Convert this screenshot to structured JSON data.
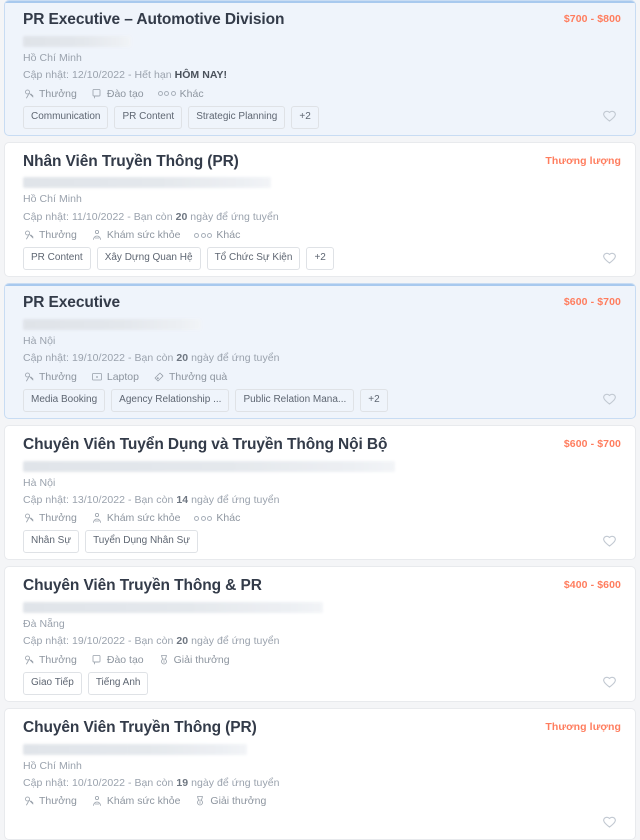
{
  "list": {
    "name": "job-search-results"
  },
  "icons": {
    "bonus": "bonus-icon",
    "training": "training-icon",
    "other": "other-benefits-icon",
    "healthcheck": "health-check-icon",
    "laptop": "laptop-icon",
    "gift": "gift-icon",
    "award": "award-icon",
    "favorite": "heart-outline-icon"
  },
  "colors": {
    "salary": "#ff7d5e",
    "highlight_bg": "#eff4fb",
    "highlight_border": "#c8dcf3",
    "title": "#333b49",
    "meta": "#9aa2ad"
  },
  "jobs": [
    {
      "title": "PR Executive – Automotive Division",
      "salary": "$700 - $800",
      "salary_type": "range",
      "location": "Hồ Chí Minh",
      "updated_prefix": "Cập nhật: ",
      "updated_date": "12/10/2022",
      "deadline_sep": " - ",
      "deadline_prefix": "Hết hạn ",
      "deadline_strong": "HÔM NAY!",
      "deadline_suffix": "",
      "highlighted": true,
      "company_width": 108,
      "benefits": [
        {
          "label": "Thưởng",
          "icon": "bonus"
        },
        {
          "label": "Đào tạo",
          "icon": "training"
        },
        {
          "label": "Khác",
          "icon": "other"
        }
      ],
      "tags": [
        "Communication",
        "PR Content",
        "Strategic Planning"
      ],
      "more_tags": "+2"
    },
    {
      "title": "Nhân Viên Truyền Thông (PR)",
      "salary": "Thương lượng",
      "salary_type": "negotiable",
      "location": "Hồ Chí Minh",
      "updated_prefix": "Cập nhật: ",
      "updated_date": "11/10/2022",
      "deadline_sep": " - ",
      "deadline_prefix": "Bạn còn ",
      "deadline_strong": "20",
      "deadline_suffix": " ngày để ứng tuyển",
      "highlighted": false,
      "company_width": 248,
      "benefits": [
        {
          "label": "Thưởng",
          "icon": "bonus"
        },
        {
          "label": "Khám sức khỏe",
          "icon": "healthcheck"
        },
        {
          "label": "Khác",
          "icon": "other"
        }
      ],
      "tags": [
        "PR Content",
        "Xây Dựng Quan Hệ",
        "Tổ Chức Sự Kiện"
      ],
      "more_tags": "+2"
    },
    {
      "title": "PR Executive",
      "salary": "$600 - $700",
      "salary_type": "range",
      "location": "Hà Nội",
      "updated_prefix": "Cập nhật: ",
      "updated_date": "19/10/2022",
      "deadline_sep": " - ",
      "deadline_prefix": "Bạn còn ",
      "deadline_strong": "20",
      "deadline_suffix": " ngày để ứng tuyển",
      "highlighted": true,
      "company_width": 178,
      "benefits": [
        {
          "label": "Thưởng",
          "icon": "bonus"
        },
        {
          "label": "Laptop",
          "icon": "laptop"
        },
        {
          "label": "Thưởng quà",
          "icon": "gift"
        }
      ],
      "tags": [
        "Media Booking",
        "Agency Relationship ...",
        "Public Relation Mana..."
      ],
      "more_tags": "+2"
    },
    {
      "title": "Chuyên Viên Tuyển Dụng và Truyền Thông Nội Bộ",
      "salary": "$600 - $700",
      "salary_type": "range",
      "location": "Hà Nội",
      "updated_prefix": "Cập nhật: ",
      "updated_date": "13/10/2022",
      "deadline_sep": " - ",
      "deadline_prefix": "Bạn còn ",
      "deadline_strong": "14",
      "deadline_suffix": " ngày để ứng tuyển",
      "highlighted": false,
      "company_width": 372,
      "benefits": [
        {
          "label": "Thưởng",
          "icon": "bonus"
        },
        {
          "label": "Khám sức khỏe",
          "icon": "healthcheck"
        },
        {
          "label": "Khác",
          "icon": "other"
        }
      ],
      "tags": [
        "Nhân Sự",
        "Tuyển Dụng Nhân Sự"
      ],
      "more_tags": ""
    },
    {
      "title": "Chuyên Viên Truyền Thông & PR",
      "salary": "$400 - $600",
      "salary_type": "range",
      "location": "Đà Nẵng",
      "updated_prefix": "Cập nhật: ",
      "updated_date": "19/10/2022",
      "deadline_sep": " - ",
      "deadline_prefix": "Bạn còn ",
      "deadline_strong": "20",
      "deadline_suffix": " ngày để ứng tuyển",
      "highlighted": false,
      "company_width": 300,
      "benefits": [
        {
          "label": "Thưởng",
          "icon": "bonus"
        },
        {
          "label": "Đào tạo",
          "icon": "training"
        },
        {
          "label": "Giải thưởng",
          "icon": "award"
        }
      ],
      "tags": [
        "Giao Tiếp",
        "Tiếng Anh"
      ],
      "more_tags": ""
    },
    {
      "title": "Chuyên Viên Truyền Thông (PR)",
      "salary": "Thương lượng",
      "salary_type": "negotiable",
      "location": "Hồ Chí Minh",
      "updated_prefix": "Cập nhật: ",
      "updated_date": "10/10/2022",
      "deadline_sep": " - ",
      "deadline_prefix": "Bạn còn ",
      "deadline_strong": "19",
      "deadline_suffix": " ngày để ứng tuyển",
      "highlighted": false,
      "company_width": 224,
      "benefits": [
        {
          "label": "Thưởng",
          "icon": "bonus"
        },
        {
          "label": "Khám sức khỏe",
          "icon": "healthcheck"
        },
        {
          "label": "Giải thưởng",
          "icon": "award"
        }
      ],
      "tags": [],
      "more_tags": ""
    }
  ]
}
